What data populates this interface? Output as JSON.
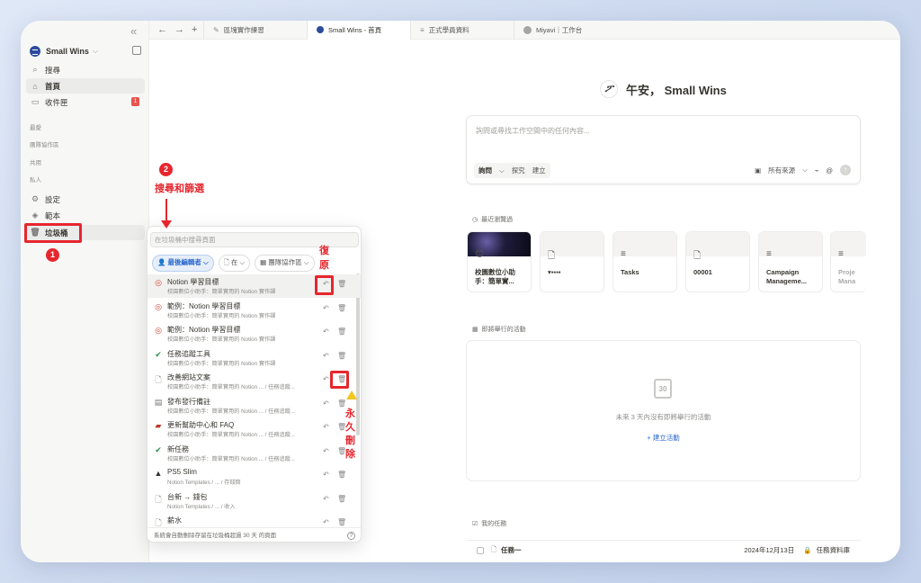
{
  "sidebar": {
    "workspace": "Small Wins",
    "nav": [
      {
        "label": "搜尋",
        "icon": "search-icon"
      },
      {
        "label": "首頁",
        "icon": "home-icon"
      },
      {
        "label": "收件匣",
        "icon": "inbox-icon",
        "badge": "1"
      }
    ],
    "sections": [
      "最愛",
      "團隊協作區",
      "共用",
      "私人"
    ],
    "bottom": [
      {
        "label": "設定",
        "icon": "gear-icon"
      },
      {
        "label": "範本",
        "icon": "template-icon"
      },
      {
        "label": "垃圾桶",
        "icon": "trash-icon"
      }
    ]
  },
  "tabs": [
    {
      "label": "區塊實作練習",
      "icon": "pencil-icon"
    },
    {
      "label": "Small Wins - 首頁",
      "icon": "workspace-icon",
      "active": true
    },
    {
      "label": "正式學員資料",
      "icon": "database-icon"
    },
    {
      "label": "Miyavi｜工作台",
      "icon": "avatar-icon"
    }
  ],
  "main": {
    "greeting": "午安， Small Wins",
    "ask_placeholder": "詢問或尋找工作空間中的任何內容...",
    "ask_modes": [
      "詢問",
      "探究",
      "建立"
    ],
    "ask_source": "所有來源",
    "recent_heading": "最近瀏覽過",
    "recent": [
      {
        "title": "校園數位小助手：簡單實..."
      },
      {
        "title": "▾▪▪▪▪"
      },
      {
        "title": "Tasks"
      },
      {
        "title": "00001"
      },
      {
        "title": "Campaign Manageme..."
      },
      {
        "title": "Proje Mana"
      }
    ],
    "events_heading": "即將舉行的活動",
    "events_icon_text": "30",
    "events_empty": "未來 3 天內沒有即將舉行的活動",
    "events_add": "+ 建立活動",
    "tasks_heading": "我的任務",
    "task": {
      "title": "任務一",
      "date": "2024年12月13日",
      "db": "任務資料庫"
    }
  },
  "trash": {
    "search_placeholder": "在垃圾桶中搜尋頁面",
    "filters": [
      "最後編輯者",
      "在",
      "團隊協作區"
    ],
    "items": [
      {
        "icon": "target-icon",
        "title": "Notion 學習目標",
        "sub": "校園數位小助手：簡單實用的 Notion 實作課"
      },
      {
        "icon": "target-icon",
        "title": "範例：Notion 學習目標",
        "sub": "校園數位小助手：簡單實用的 Notion 實作課"
      },
      {
        "icon": "target-icon",
        "title": "範例：Notion 學習目標",
        "sub": "校園數位小助手：簡單實用的 Notion 實作課"
      },
      {
        "icon": "check-icon",
        "title": "任務追蹤工具",
        "sub": "校園數位小助手：簡單實用的 Notion 實作課"
      },
      {
        "icon": "page-icon",
        "title": "改善網站文案",
        "sub": "校園數位小助手：簡單實用的 Notion ... / 任務追蹤..."
      },
      {
        "icon": "note-icon",
        "title": "發布發行備註",
        "sub": "校園數位小助手：簡單實用的 Notion ... / 任務追蹤..."
      },
      {
        "icon": "book-icon",
        "title": "更新幫助中心和 FAQ",
        "sub": "校園數位小助手：簡單實用的 Notion ... / 任務追蹤..."
      },
      {
        "icon": "check-icon",
        "title": "新任務",
        "sub": "校園數位小助手：簡單實用的 Notion ... / 任務追蹤..."
      },
      {
        "icon": "bag-icon",
        "title": "PS5 Slim",
        "sub": "Notion Templates / ... / 存錢筒"
      },
      {
        "icon": "page-icon",
        "title": "台新 → 錢包",
        "sub": "Notion Templates / ... / 收入"
      },
      {
        "icon": "page-icon",
        "title": "薪水",
        "sub": ""
      }
    ],
    "footer": "系統會自動刪除存留在垃圾桶超過 30 天 的頁面"
  },
  "annotations": {
    "n1": "1",
    "n2": "2",
    "search_filter": "搜尋和篩選",
    "restore_1": "復",
    "restore_2": "原",
    "delete_1": "永",
    "delete_2": "久",
    "delete_3": "刪",
    "delete_4": "除"
  }
}
